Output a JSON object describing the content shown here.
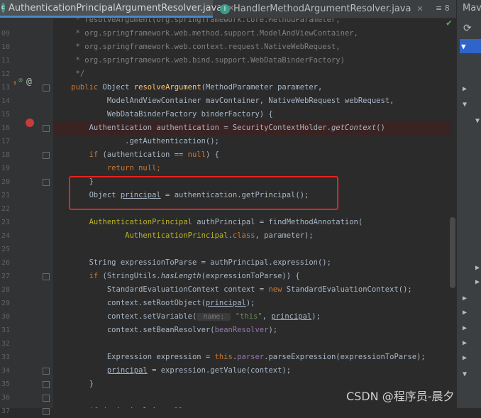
{
  "tabs": [
    {
      "label": "AuthenticationPrincipalArgumentResolver.java",
      "active": true
    },
    {
      "label": "HandlerMethodArgumentResolver.java",
      "active": false
    }
  ],
  "tab_menu": "≡ 8",
  "tool_window": {
    "label": "Mave"
  },
  "watermark": "CSDN @程序员-晨夕",
  "code_lines": [
    {
      "n": "",
      "parts": [
        {
          "t": "     * resolveArgument(org.springframework.core.MethodParameter,",
          "c": "cm"
        }
      ]
    },
    {
      "n": "09",
      "parts": [
        {
          "t": "     * org.springframework.web.method.support.ModelAndViewContainer,",
          "c": "cm"
        }
      ]
    },
    {
      "n": "10",
      "parts": [
        {
          "t": "     * org.springframework.web.context.request.NativeWebRequest,",
          "c": "cm"
        }
      ]
    },
    {
      "n": "11",
      "parts": [
        {
          "t": "     * org.springframework.web.bind.support.WebDataBinderFactory)",
          "c": "cm"
        }
      ]
    },
    {
      "n": "12",
      "parts": [
        {
          "t": "     */",
          "c": "cm"
        }
      ]
    },
    {
      "n": "13",
      "parts": [
        {
          "t": "    public ",
          "c": "kw"
        },
        {
          "t": "Object ",
          "c": ""
        },
        {
          "t": "resolveArgument",
          "c": "fn"
        },
        {
          "t": "(MethodParameter parameter,",
          "c": ""
        }
      ]
    },
    {
      "n": "14",
      "parts": [
        {
          "t": "            ModelAndViewContainer mavContainer, NativeWebRequest webRequest,",
          "c": ""
        }
      ]
    },
    {
      "n": "15",
      "parts": [
        {
          "t": "            WebDataBinderFactory binderFactory) {",
          "c": ""
        }
      ]
    },
    {
      "n": "16",
      "parts": [
        {
          "t": "        Authentication authentication = SecurityContextHolder.",
          "c": ""
        },
        {
          "t": "getContext",
          "c": "it"
        },
        {
          "t": "()",
          "c": ""
        }
      ],
      "breakpoint": true
    },
    {
      "n": "17",
      "parts": [
        {
          "t": "                .getAuthentication();",
          "c": ""
        }
      ]
    },
    {
      "n": "18",
      "parts": [
        {
          "t": "        if ",
          "c": "kw"
        },
        {
          "t": "(authentication == ",
          "c": ""
        },
        {
          "t": "null",
          "c": "kw"
        },
        {
          "t": ") {",
          "c": ""
        }
      ]
    },
    {
      "n": "19",
      "parts": [
        {
          "t": "            return null",
          "c": "kw"
        },
        {
          "t": ";",
          "c": "kw"
        }
      ]
    },
    {
      "n": "20",
      "parts": [
        {
          "t": "        }",
          "c": ""
        }
      ]
    },
    {
      "n": "21",
      "parts": [
        {
          "t": "        Object ",
          "c": ""
        },
        {
          "t": "principal",
          "c": "ul"
        },
        {
          "t": " = authentication.getPrincipal();",
          "c": ""
        }
      ]
    },
    {
      "n": "22",
      "parts": [
        {
          "t": "",
          "c": ""
        }
      ]
    },
    {
      "n": "23",
      "parts": [
        {
          "t": "        AuthenticationPrincipal ",
          "c": "ann"
        },
        {
          "t": "authPrincipal = findMethodAnnotation(",
          "c": ""
        }
      ]
    },
    {
      "n": "24",
      "parts": [
        {
          "t": "                AuthenticationPrincipal",
          "c": "ann"
        },
        {
          "t": ".",
          "c": ""
        },
        {
          "t": "class",
          "c": "kw"
        },
        {
          "t": ", parameter);",
          "c": ""
        }
      ]
    },
    {
      "n": "25",
      "parts": [
        {
          "t": "",
          "c": ""
        }
      ]
    },
    {
      "n": "26",
      "parts": [
        {
          "t": "        String expressionToParse = authPrincipal.expression();",
          "c": ""
        }
      ]
    },
    {
      "n": "27",
      "parts": [
        {
          "t": "        if ",
          "c": "kw"
        },
        {
          "t": "(StringUtils.",
          "c": ""
        },
        {
          "t": "hasLength",
          "c": "it"
        },
        {
          "t": "(expressionToParse)) {",
          "c": ""
        }
      ]
    },
    {
      "n": "28",
      "parts": [
        {
          "t": "            StandardEvaluationContext context = ",
          "c": ""
        },
        {
          "t": "new ",
          "c": "kw"
        },
        {
          "t": "StandardEvaluationContext();",
          "c": ""
        }
      ]
    },
    {
      "n": "29",
      "parts": [
        {
          "t": "            context.setRootObject(",
          "c": ""
        },
        {
          "t": "principal",
          "c": "ul"
        },
        {
          "t": ");",
          "c": ""
        }
      ]
    },
    {
      "n": "30",
      "parts": [
        {
          "t": "            context.setVariable(",
          "c": ""
        },
        {
          "t": " name: ",
          "c": "hint"
        },
        {
          "t": " \"this\"",
          "c": "st"
        },
        {
          "t": ", ",
          "c": ""
        },
        {
          "t": "principal",
          "c": "ul"
        },
        {
          "t": ");",
          "c": ""
        }
      ]
    },
    {
      "n": "31",
      "parts": [
        {
          "t": "            context.setBeanResolver(",
          "c": ""
        },
        {
          "t": "beanResolver",
          "c": "fld"
        },
        {
          "t": ");",
          "c": ""
        }
      ]
    },
    {
      "n": "32",
      "parts": [
        {
          "t": "",
          "c": ""
        }
      ]
    },
    {
      "n": "33",
      "parts": [
        {
          "t": "            Expression expression = ",
          "c": ""
        },
        {
          "t": "this",
          "c": "kw"
        },
        {
          "t": ".",
          "c": ""
        },
        {
          "t": "parser",
          "c": "fld"
        },
        {
          "t": ".parseExpression(expressionToParse);",
          "c": ""
        }
      ]
    },
    {
      "n": "34",
      "parts": [
        {
          "t": "            ",
          "c": ""
        },
        {
          "t": "principal",
          "c": "ul"
        },
        {
          "t": " = expression.getValue(context);",
          "c": ""
        }
      ]
    },
    {
      "n": "35",
      "parts": [
        {
          "t": "        }",
          "c": ""
        }
      ]
    },
    {
      "n": "36",
      "parts": [
        {
          "t": "",
          "c": ""
        }
      ]
    },
    {
      "n": "37",
      "parts": [
        {
          "t": "        if ",
          "c": "kw"
        },
        {
          "t": "(principal != ",
          "c": ""
        },
        {
          "t": "null",
          "c": "kw"
        }
      ]
    }
  ]
}
